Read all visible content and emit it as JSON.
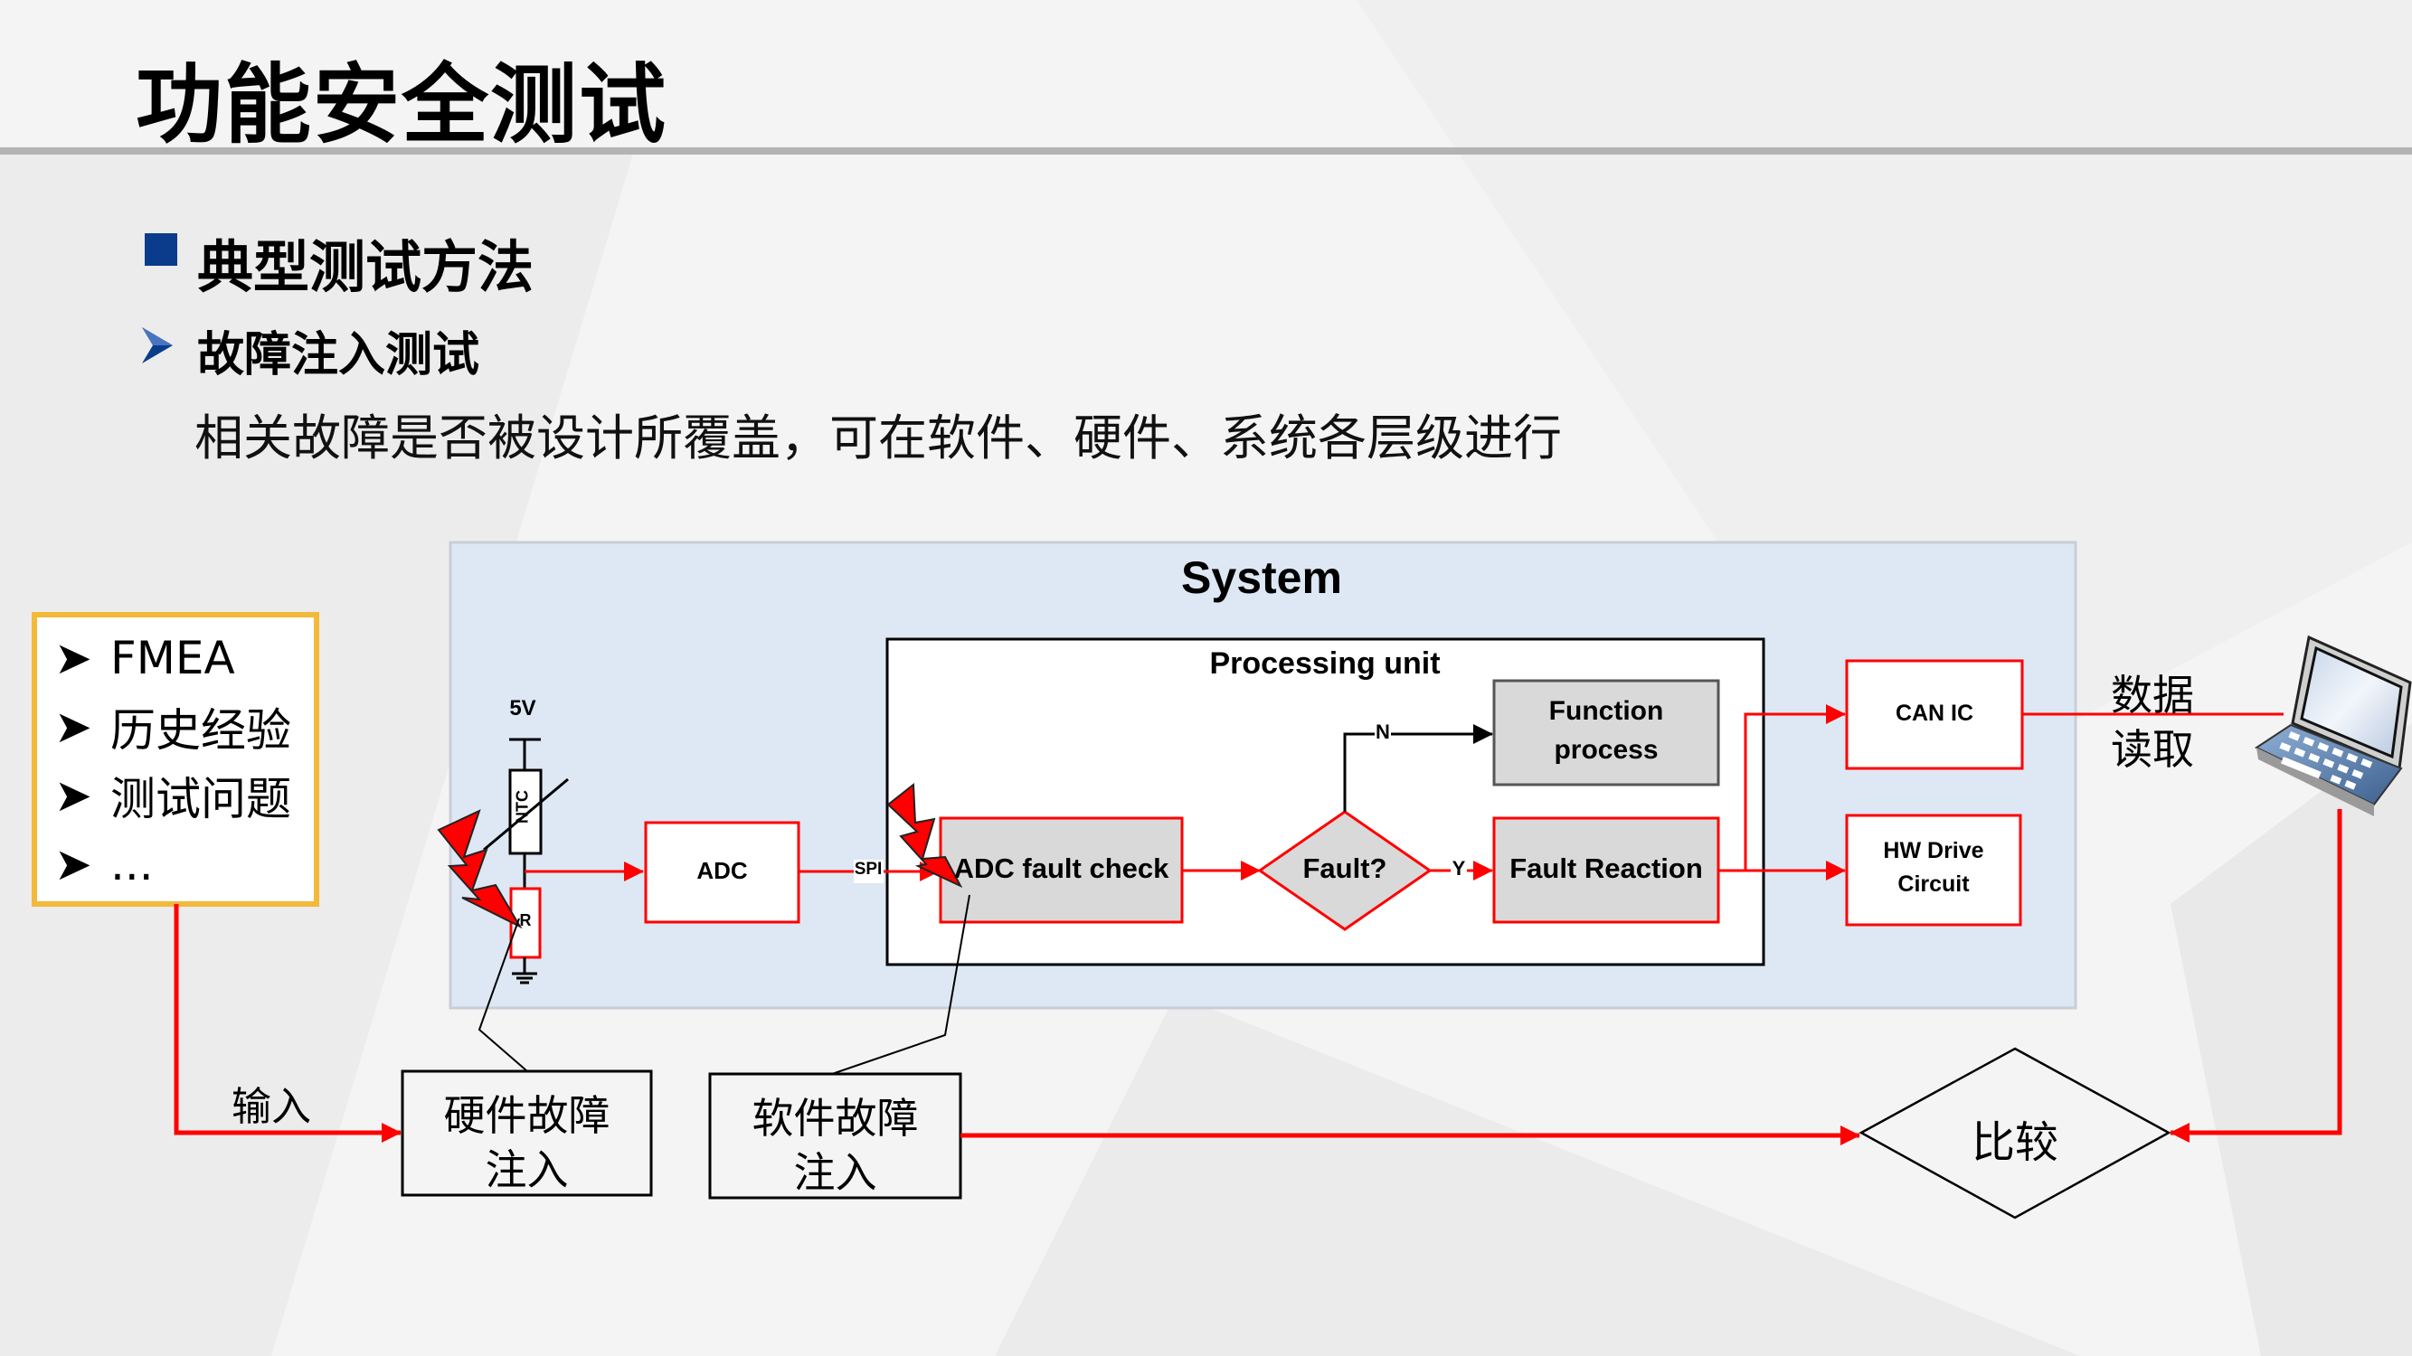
{
  "slide": {
    "title": "功能安全测试",
    "section_heading": "典型测试方法",
    "subsection_heading": "故障注入测试",
    "description": "相关故障是否被设计所覆盖，可在软件、硬件、系统各层级进行"
  },
  "colors": {
    "accent_blue": "#0b3c8c",
    "signal_red": "#ff0000",
    "system_fill": "#dde8f4",
    "block_gray": "#d9d9d9",
    "source_box_border": "#f2b93b"
  },
  "diagram": {
    "sources_box": {
      "items": [
        "FMEA",
        "历史经验",
        "测试问题",
        "..."
      ]
    },
    "system_label": "System",
    "processing_unit_label": "Processing unit",
    "circuit": {
      "supply_label": "5V",
      "ntc_label": "NTC",
      "resistor_label": "R"
    },
    "blocks": {
      "adc": "ADC",
      "spi_label": "SPI",
      "adc_fault_check": "ADC fault check",
      "fault_decision": "Fault?",
      "no_label": "N",
      "yes_label": "Y",
      "function_process_line1": "Function",
      "function_process_line2": "process",
      "fault_reaction": "Fault Reaction",
      "can_ic": "CAN IC",
      "hw_drive_line1": "HW Drive",
      "hw_drive_line2": "Circuit"
    },
    "data_read_line1": "数据",
    "data_read_line2": "读取",
    "input_label": "输入",
    "hw_fault_injection_line1": "硬件故障",
    "hw_fault_injection_line2": "注入",
    "sw_fault_injection_line1": "软件故障",
    "sw_fault_injection_line2": "注入",
    "compare_label": "比较",
    "icons": {
      "laptop": "laptop-icon",
      "lightning": "lightning-bolt-icon",
      "ground": "ground-icon"
    }
  }
}
